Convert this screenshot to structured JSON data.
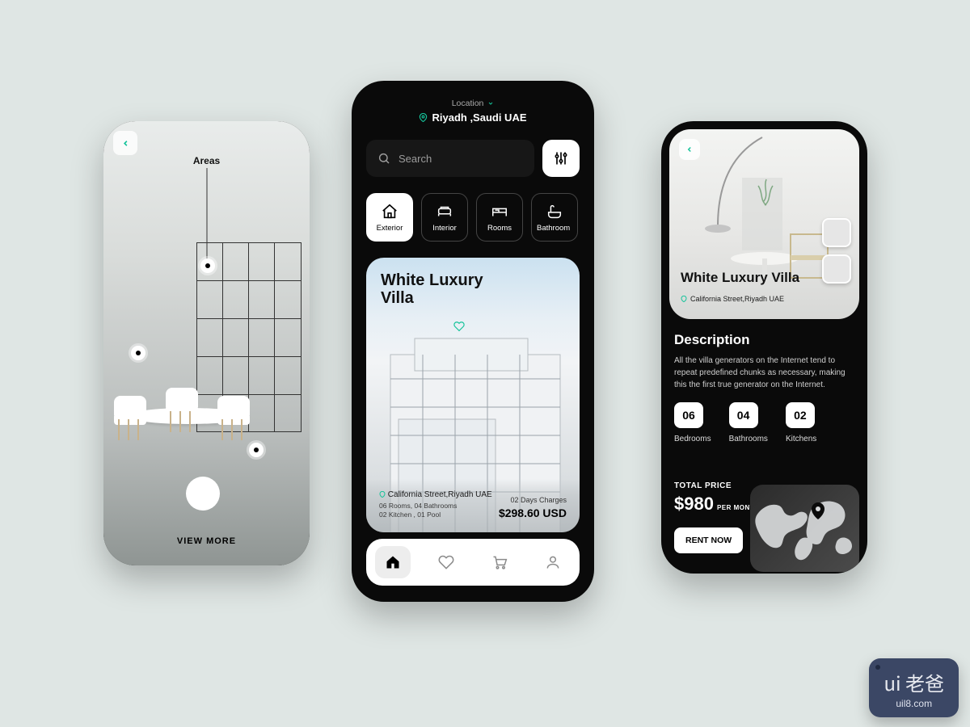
{
  "accent": "#15c39a",
  "screen1": {
    "areas_label": "Areas",
    "view_more": "VIEW MORE"
  },
  "screen2": {
    "location_label": "Location",
    "location_value": "Riyadh ,Saudi UAE",
    "search_placeholder": "Search",
    "categories": [
      {
        "key": "exterior",
        "label": "Exterior",
        "active": true
      },
      {
        "key": "interior",
        "label": "Interior"
      },
      {
        "key": "rooms",
        "label": "Rooms"
      },
      {
        "key": "bathroom",
        "label": "Bathroom"
      }
    ],
    "card": {
      "title": "White Luxury Villa",
      "address": "California Street,Riyadh UAE",
      "meta_line1": "06 Rooms, 04 Bathrooms",
      "meta_line2": "02 Kitchen , 01 Pool",
      "charges_label": "02 Days Charges",
      "price": "$298.60 USD"
    },
    "nav": [
      "home",
      "favorites",
      "cart",
      "profile"
    ]
  },
  "screen3": {
    "title": "White Luxury Villa",
    "address": "California Street,Riyadh UAE",
    "description_heading": "Description",
    "description_text": "All the villa generators on the Internet tend to repeat predefined chunks as necessary, making this the first true generator on the Internet.",
    "counts": [
      {
        "value": "06",
        "label": "Bedrooms"
      },
      {
        "value": "04",
        "label": "Bathrooms"
      },
      {
        "value": "02",
        "label": "Kitchens"
      }
    ],
    "total_label": "TOTAL PRICE",
    "total_price": "$980",
    "per_month": "PER MONTH",
    "rent_button": "RENT NOW"
  },
  "watermark": {
    "cn": "ui 老爸",
    "url": "uil8.com"
  }
}
